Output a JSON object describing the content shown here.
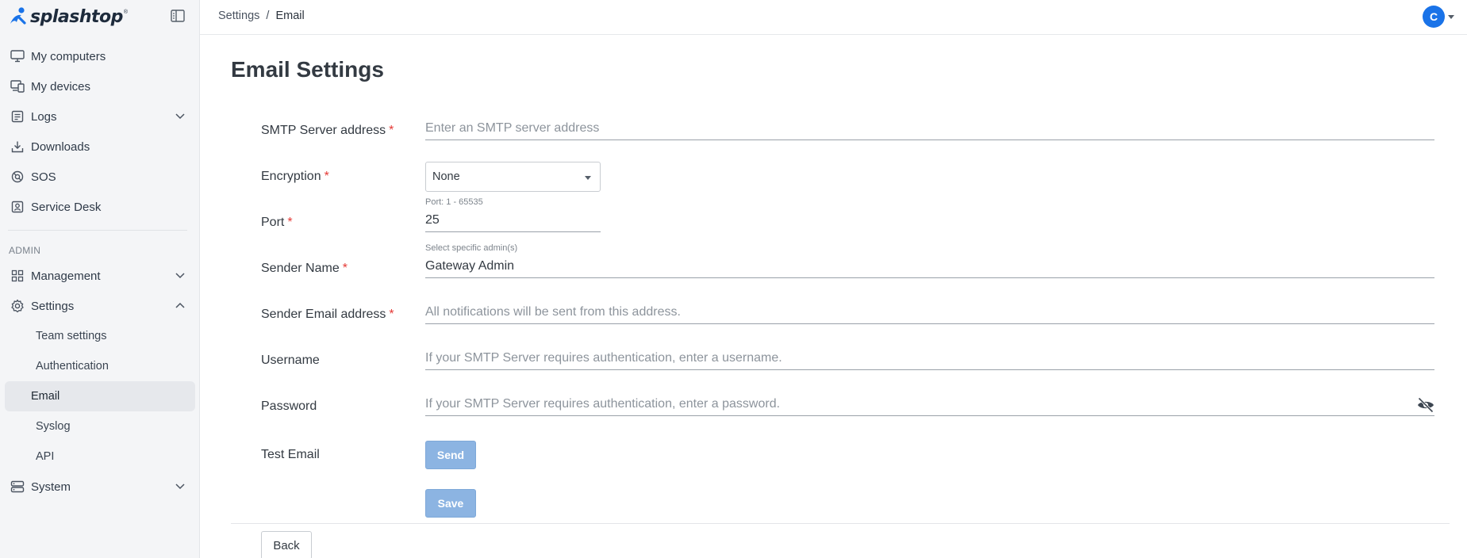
{
  "app": {
    "brand": "splashtop",
    "brand_mark": "®"
  },
  "sidebar": {
    "items": [
      {
        "label": "My computers",
        "icon": "monitor-icon"
      },
      {
        "label": "My devices",
        "icon": "devices-icon"
      },
      {
        "label": "Logs",
        "icon": "logs-icon"
      },
      {
        "label": "Downloads",
        "icon": "download-icon"
      },
      {
        "label": "SOS",
        "icon": "sos-icon"
      },
      {
        "label": "Service Desk",
        "icon": "service-desk-icon"
      }
    ],
    "admin_label": "ADMIN",
    "admin_items": [
      {
        "label": "Management",
        "icon": "grid-icon"
      },
      {
        "label": "Settings",
        "icon": "gear-icon"
      }
    ],
    "settings_sub": [
      "Team settings",
      "Authentication",
      "Email",
      "Syslog",
      "API"
    ],
    "system_label": "System"
  },
  "header": {
    "breadcrumb_parent": "Settings",
    "breadcrumb_sep": "/",
    "breadcrumb_current": "Email",
    "avatar_initial": "C"
  },
  "page": {
    "title": "Email Settings",
    "smtp_label": "SMTP Server address",
    "smtp_placeholder": "Enter an SMTP server address",
    "encryption_label": "Encryption",
    "encryption_value": "None",
    "port_helper": "Port: 1 - 65535",
    "port_label": "Port",
    "port_value": "25",
    "sender_helper": "Select specific admin(s)",
    "sender_name_label": "Sender Name",
    "sender_name_value": "Gateway Admin",
    "sender_email_label": "Sender Email address",
    "sender_email_placeholder": "All notifications will be sent from this address.",
    "username_label": "Username",
    "username_placeholder": "If your SMTP Server requires authentication, enter a username.",
    "password_label": "Password",
    "password_placeholder": "If your SMTP Server requires authentication, enter a password.",
    "test_email_label": "Test Email",
    "send_label": "Send",
    "save_label": "Save",
    "back_label": "Back",
    "required_mark": "*"
  },
  "colors": {
    "accent": "#1a73e8",
    "button_disabled": "#8cb4e2",
    "required": "#e53935",
    "sidebar_bg": "#f4f5f7"
  }
}
